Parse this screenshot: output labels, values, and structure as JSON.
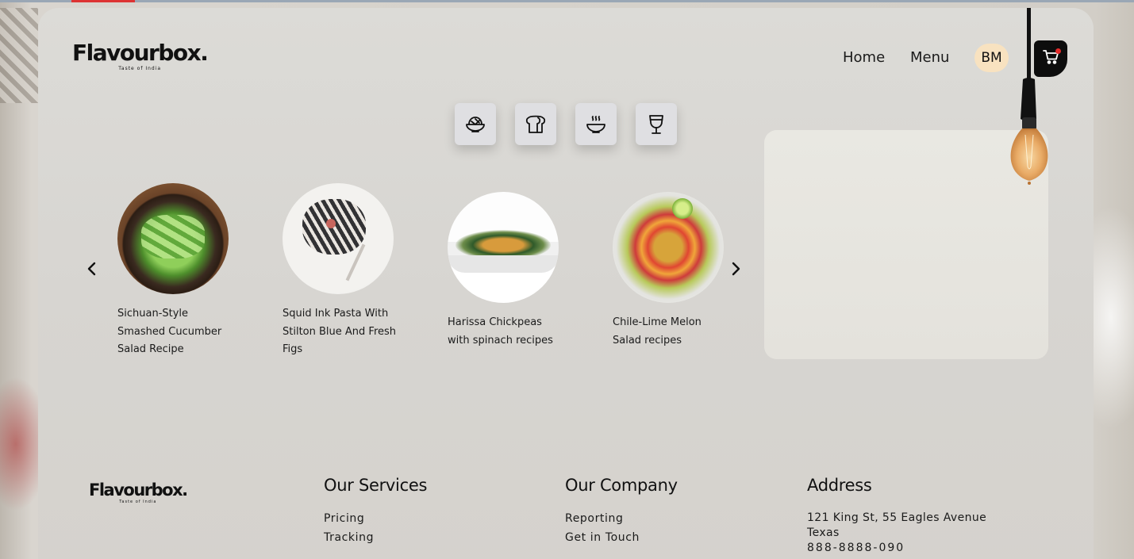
{
  "brand": {
    "name": "Flavourbox.",
    "tagline": "Taste of India"
  },
  "nav": {
    "home": "Home",
    "menu": "Menu",
    "avatar_initials": "BM"
  },
  "categories": [
    {
      "icon": "salad-bowl-icon"
    },
    {
      "icon": "bread-icon"
    },
    {
      "icon": "hot-soup-icon"
    },
    {
      "icon": "drink-glass-icon"
    }
  ],
  "recipes": [
    {
      "title": "Sichuan-Style Smashed Cucumber Salad Recipe"
    },
    {
      "title": "Squid Ink Pasta With Stilton Blue And Fresh Figs"
    },
    {
      "title": "Harissa Chickpeas with spinach recipes"
    },
    {
      "title": "Chile-Lime Melon Salad recipes"
    }
  ],
  "footer": {
    "services": {
      "heading": "Our Services",
      "links": [
        "Pricing",
        "Tracking"
      ]
    },
    "company": {
      "heading": "Our Company",
      "links": [
        "Reporting",
        "Get in Touch"
      ]
    },
    "address": {
      "heading": "Address",
      "line1": "121 King St, 55 Eagles Avenue",
      "line2": "Texas",
      "phone": "888-8888-090"
    }
  },
  "colors": {
    "avatar_bg": "#f8e2c0",
    "cart_bg": "#0d0d0d",
    "cart_dot": "#e42b2b"
  }
}
